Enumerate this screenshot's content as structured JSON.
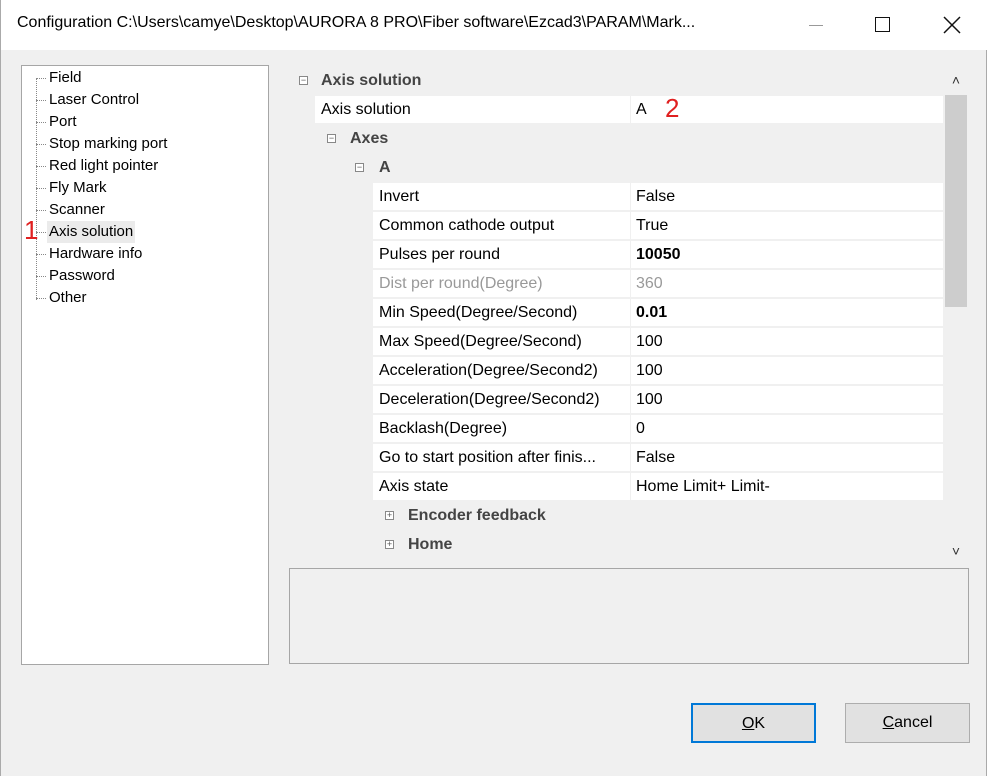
{
  "window": {
    "title": "Configuration C:\\Users\\camye\\Desktop\\AURORA 8 PRO\\Fiber software\\Ezcad3\\PARAM\\Mark...",
    "minimize_icon": "minimize-icon",
    "maximize_icon": "maximize-icon",
    "close_icon": "close-icon"
  },
  "tree": {
    "items": [
      {
        "label": "Field"
      },
      {
        "label": "Laser Control"
      },
      {
        "label": "Port"
      },
      {
        "label": "Stop marking port"
      },
      {
        "label": "Red light pointer"
      },
      {
        "label": "Fly Mark"
      },
      {
        "label": "Scanner"
      },
      {
        "label": "Axis solution",
        "selected": true
      },
      {
        "label": "Hardware info"
      },
      {
        "label": "Password"
      },
      {
        "label": "Other"
      }
    ]
  },
  "annotations": {
    "one": "1",
    "two": "2",
    "color": "#e02020"
  },
  "grid": {
    "cat_axis_solution": "Axis solution",
    "axis_solution_name": "Axis solution",
    "axis_solution_value": "A",
    "cat_axes": "Axes",
    "cat_a": "A",
    "props": [
      {
        "name": "Invert",
        "value": "False"
      },
      {
        "name": "Common cathode output",
        "value": "True"
      },
      {
        "name": "Pulses per round",
        "value": "10050"
      },
      {
        "name": "Dist per round(Degree)",
        "value": "360"
      },
      {
        "name": "Min Speed(Degree/Second)",
        "value": "0.01"
      },
      {
        "name": "Max Speed(Degree/Second)",
        "value": "100"
      },
      {
        "name": "Acceleration(Degree/Second2)",
        "value": "100"
      },
      {
        "name": "Deceleration(Degree/Second2)",
        "value": "100"
      },
      {
        "name": "Backlash(Degree)",
        "value": "0"
      },
      {
        "name": "Go to start position after finis...",
        "value": "False"
      },
      {
        "name": "Axis state",
        "value": "Home Limit+ Limit-"
      }
    ],
    "cat_encoder": "Encoder feedback",
    "cat_home": "Home"
  },
  "buttons": {
    "ok_hotkey": "O",
    "ok_rest": "K",
    "cancel_hotkey": "C",
    "cancel_rest": "ancel"
  },
  "colors": {
    "focus_border": "#0078d7",
    "selection": "#ebebeb"
  }
}
